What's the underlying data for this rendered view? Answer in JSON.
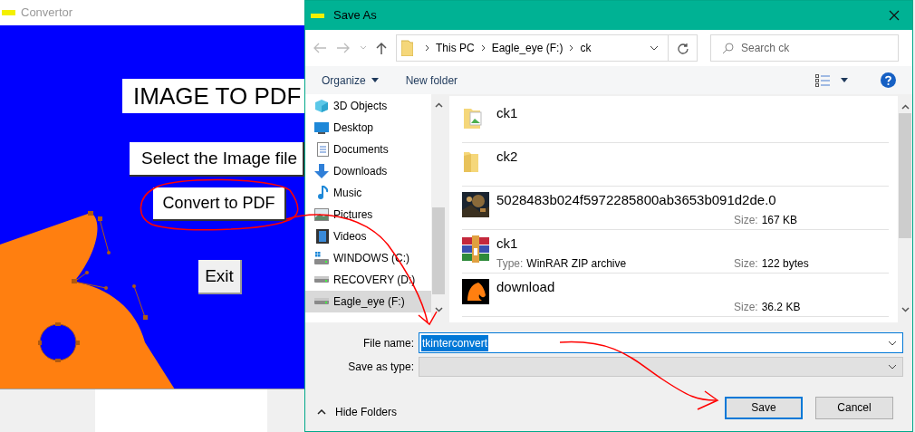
{
  "app_window": {
    "title": "Convertor",
    "heading": "IMAGE TO PDF",
    "buttons": [
      {
        "label": "Select the Image file",
        "kind": "primary"
      },
      {
        "label": "Convert to PDF",
        "kind": "primary"
      },
      {
        "label": "Exit",
        "kind": "exit"
      }
    ]
  },
  "dialog": {
    "title": "Save As",
    "breadcrumb": [
      "This PC",
      "Eagle_eye (F:)",
      "ck"
    ],
    "search": {
      "placeholder": "Search ck"
    },
    "toolbar": {
      "organize": "Organize",
      "new_folder": "New folder"
    },
    "nav_items": [
      {
        "label": "3D Objects",
        "kind": "objects",
        "selected": false
      },
      {
        "label": "Desktop",
        "kind": "desktop",
        "selected": false
      },
      {
        "label": "Documents",
        "kind": "documents",
        "selected": false
      },
      {
        "label": "Downloads",
        "kind": "downloads",
        "selected": false
      },
      {
        "label": "Music",
        "kind": "music",
        "selected": false
      },
      {
        "label": "Pictures",
        "kind": "pictures",
        "selected": false
      },
      {
        "label": "Videos",
        "kind": "videos",
        "selected": false
      },
      {
        "label": "WINDOWS (C:)",
        "kind": "system-drive",
        "selected": false
      },
      {
        "label": "RECOVERY (D:)",
        "kind": "drive",
        "selected": false
      },
      {
        "label": "Eagle_eye (F:)",
        "kind": "drive",
        "selected": true
      }
    ],
    "files": [
      {
        "name": "ck1",
        "kind": "image-folder"
      },
      {
        "name": "ck2",
        "kind": "folder"
      },
      {
        "name": "5028483b024f5972285800ab3653b091d2de.0",
        "size": {
          "label": "Size:",
          "value": "167 KB"
        }
      },
      {
        "name": "ck1",
        "kind": "archive",
        "type": {
          "label": "Type:",
          "value": "WinRAR ZIP archive"
        },
        "size": {
          "label": "Size:",
          "value": "122 bytes"
        }
      },
      {
        "name": "download",
        "kind": "horse",
        "size": {
          "label": "Size:",
          "value": "36.2 KB"
        }
      }
    ],
    "file_name": {
      "label": "File name:",
      "value": "tkinterconvert"
    },
    "save_as_type": {
      "label": "Save as type:"
    },
    "hide_folders": "Hide Folders",
    "buttons": [
      {
        "label": "Save",
        "default": true
      },
      {
        "label": "Cancel",
        "default": false
      }
    ]
  }
}
